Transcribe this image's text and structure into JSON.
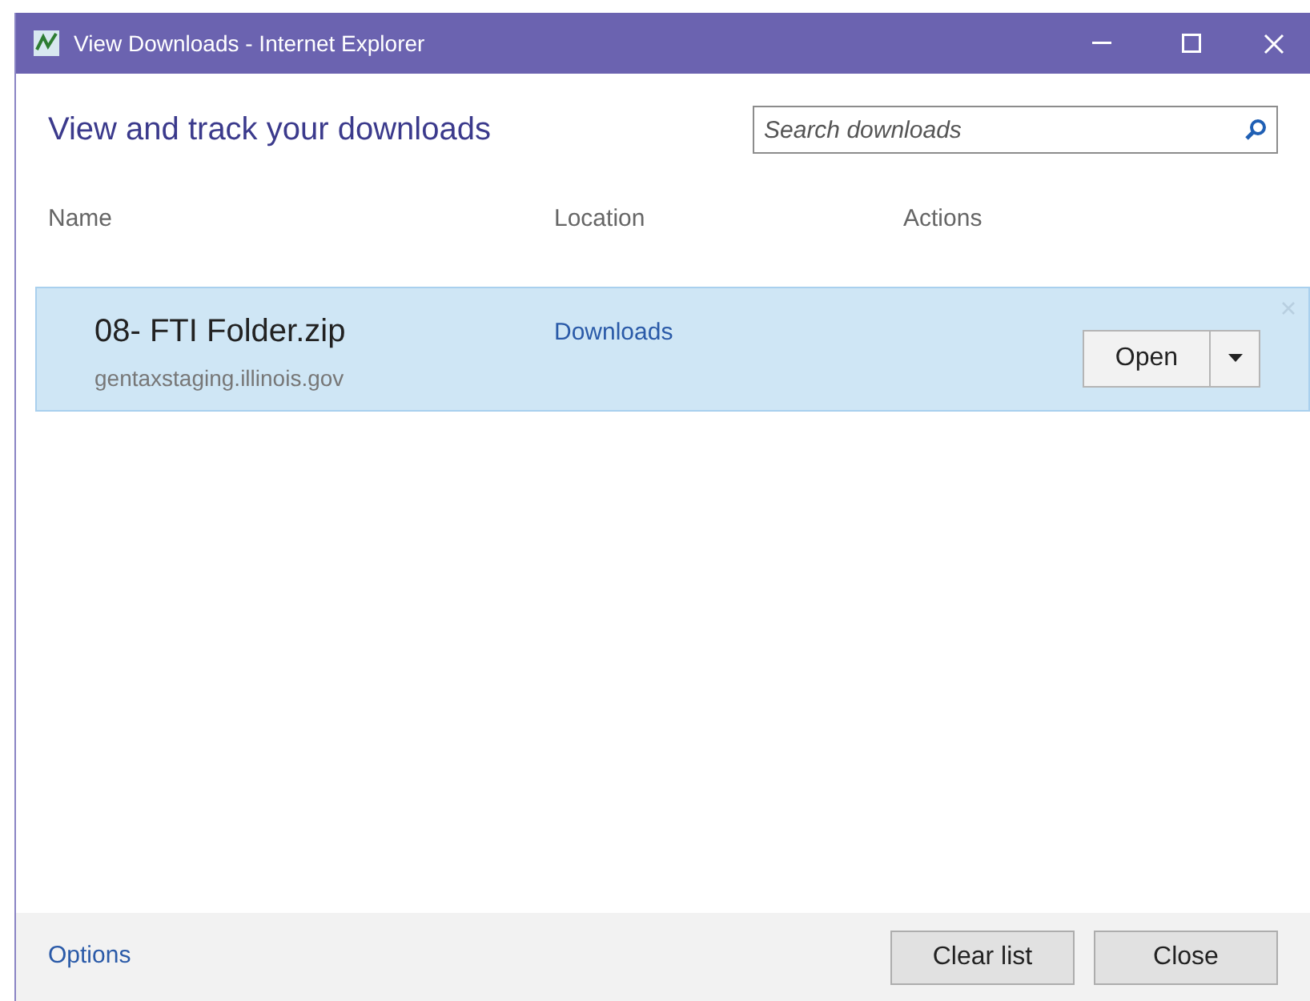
{
  "window": {
    "title": "View Downloads - Internet Explorer"
  },
  "heading": "View and track your downloads",
  "search": {
    "placeholder": "Search downloads"
  },
  "columns": [
    "Name",
    "Location",
    "Actions"
  ],
  "downloads": [
    {
      "file": "08- FTI Folder.zip",
      "source": "gentaxstaging.illinois.gov",
      "location": "Downloads",
      "action": "Open",
      "selected": true
    }
  ],
  "footer": {
    "link": "Options",
    "buttons": [
      "Clear list",
      "Close"
    ]
  }
}
